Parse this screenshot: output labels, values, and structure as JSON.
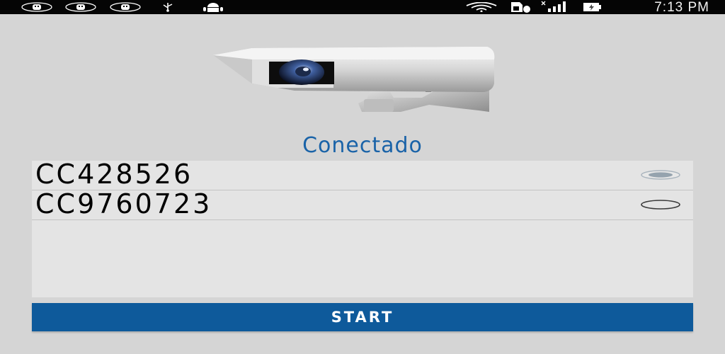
{
  "status_bar": {
    "time": "7:13 PM",
    "icons": [
      "android-debug-icon",
      "android-debug-icon",
      "android-debug-icon",
      "usb-icon",
      "android-icon",
      "wifi-icon",
      "sim-card-icon",
      "signal-icon",
      "battery-icon"
    ]
  },
  "main": {
    "status_text": "Conectado",
    "devices": [
      {
        "name": "CC428526",
        "selected": true
      },
      {
        "name": "CC9760723",
        "selected": false
      }
    ],
    "start_label": "START"
  },
  "colors": {
    "accent": "#0e5a9b",
    "status_text": "#1a63a8",
    "background": "#d5d5d5",
    "list_bg": "#e4e4e4"
  }
}
